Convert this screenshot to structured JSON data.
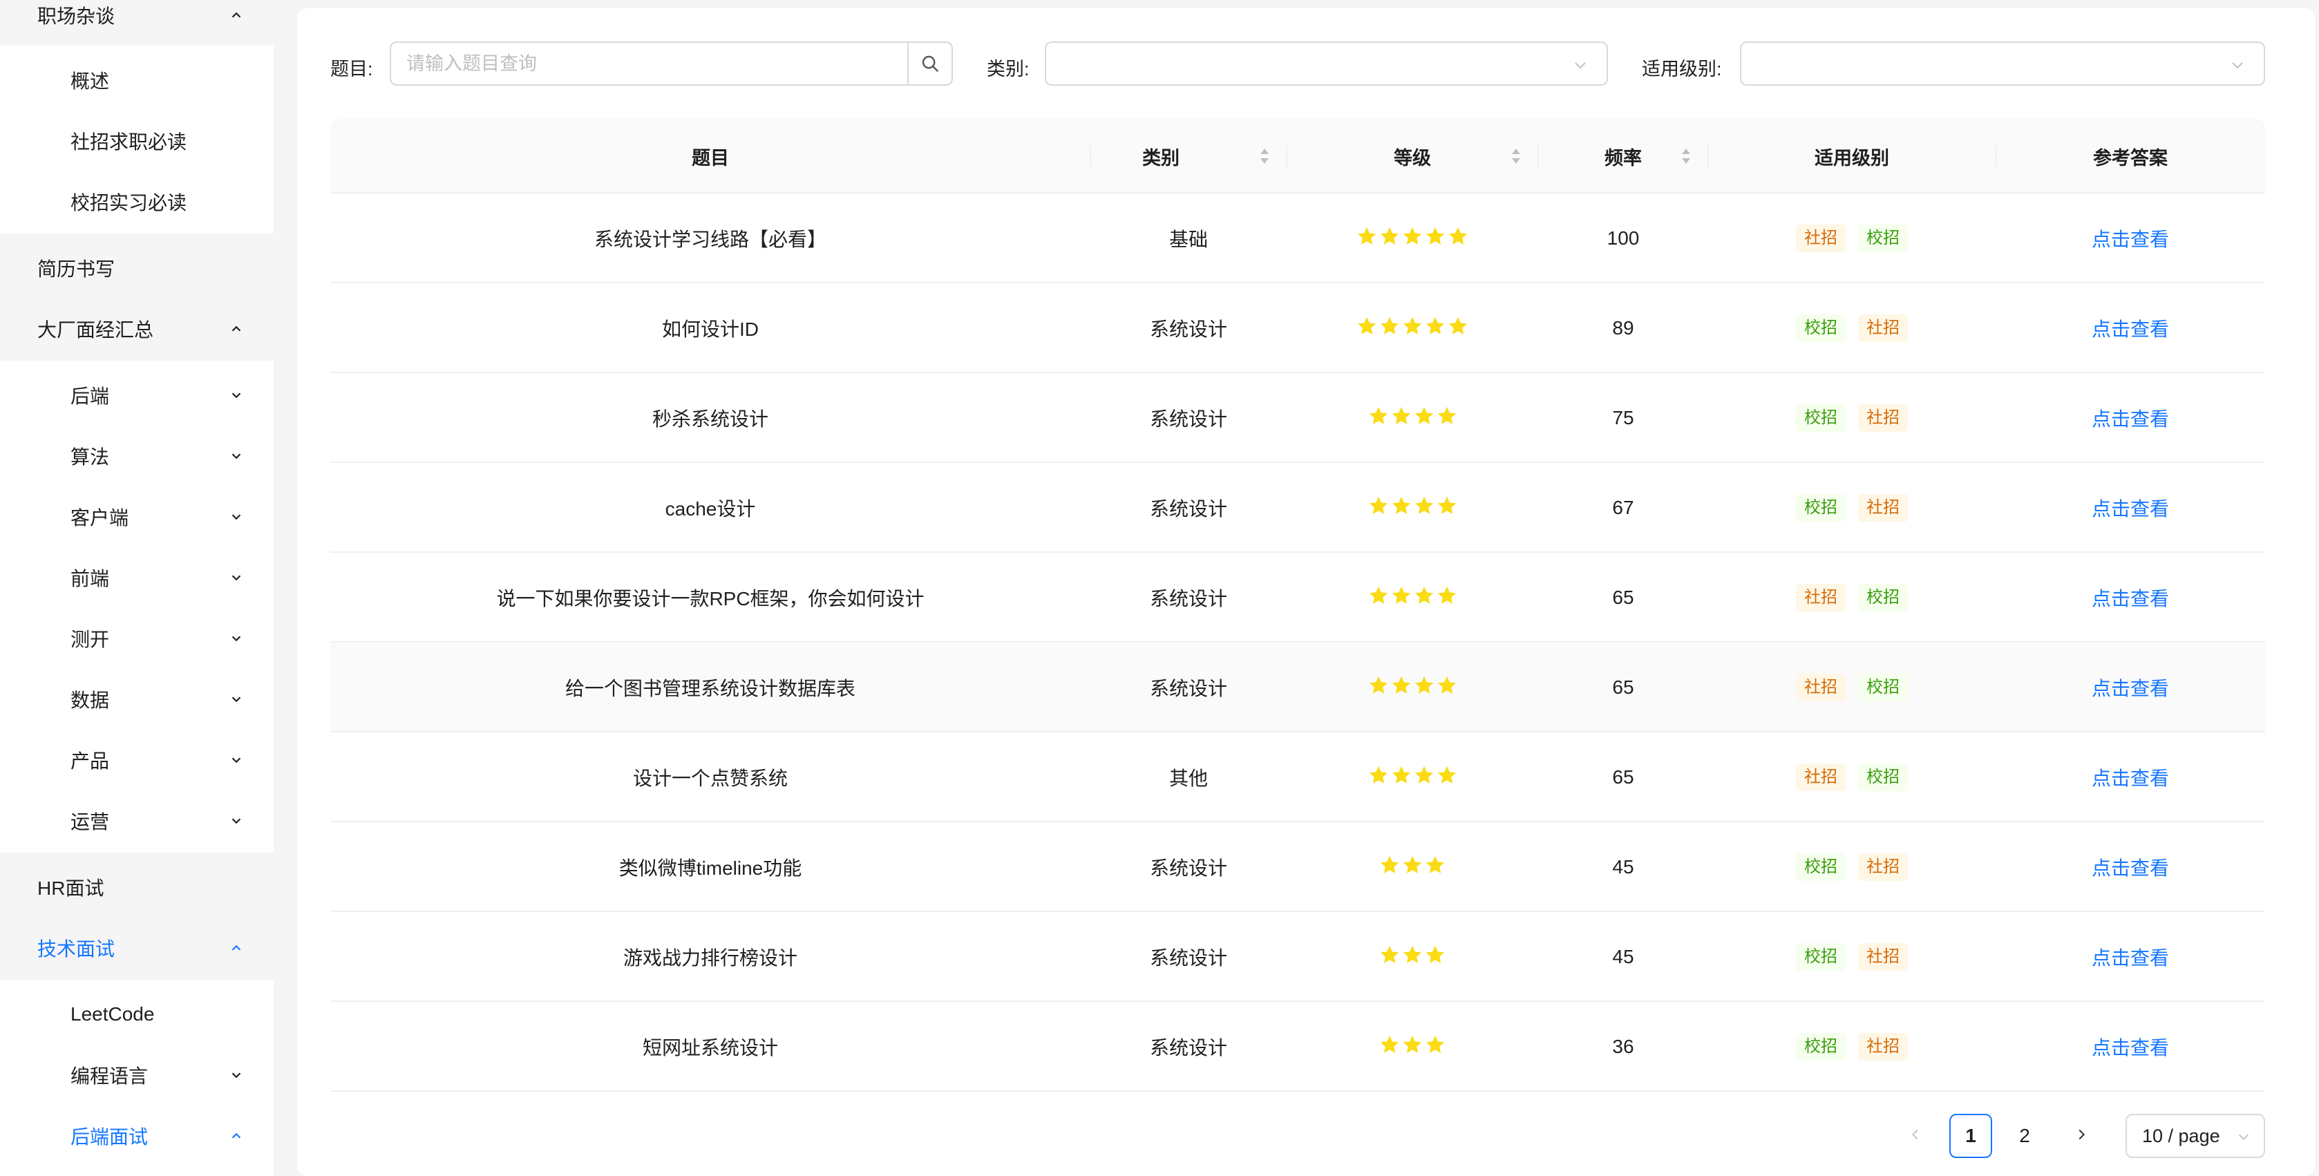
{
  "sidebar": {
    "items": [
      {
        "label": "职场杂谈",
        "level": 1,
        "expanded": true,
        "active": false,
        "chevron": "up"
      },
      {
        "label": "概述",
        "level": 2,
        "active": false,
        "chevron": null
      },
      {
        "label": "社招求职必读",
        "level": 2,
        "active": false,
        "chevron": null
      },
      {
        "label": "校招实习必读",
        "level": 2,
        "active": false,
        "chevron": null
      },
      {
        "label": "简历书写",
        "level": 1,
        "active": false,
        "chevron": null
      },
      {
        "label": "大厂面经汇总",
        "level": 1,
        "expanded": true,
        "active": false,
        "chevron": "up"
      },
      {
        "label": "后端",
        "level": 2,
        "active": false,
        "chevron": "down"
      },
      {
        "label": "算法",
        "level": 2,
        "active": false,
        "chevron": "down"
      },
      {
        "label": "客户端",
        "level": 2,
        "active": false,
        "chevron": "down"
      },
      {
        "label": "前端",
        "level": 2,
        "active": false,
        "chevron": "down"
      },
      {
        "label": "测开",
        "level": 2,
        "active": false,
        "chevron": "down"
      },
      {
        "label": "数据",
        "level": 2,
        "active": false,
        "chevron": "down"
      },
      {
        "label": "产品",
        "level": 2,
        "active": false,
        "chevron": "down"
      },
      {
        "label": "运营",
        "level": 2,
        "active": false,
        "chevron": "down"
      },
      {
        "label": "HR面试",
        "level": 1,
        "active": false,
        "chevron": null
      },
      {
        "label": "技术面试",
        "level": 1,
        "expanded": true,
        "active": true,
        "chevron": "up"
      },
      {
        "label": "LeetCode",
        "level": 2,
        "active": false,
        "chevron": null
      },
      {
        "label": "编程语言",
        "level": 2,
        "active": false,
        "chevron": "down"
      },
      {
        "label": "后端面试",
        "level": 2,
        "active": true,
        "chevron": "up"
      }
    ]
  },
  "filters": {
    "title_label": "题目:",
    "title_placeholder": "请输入题目查询",
    "title_value": "",
    "category_label": "类别:",
    "category_value": "",
    "level_label": "适用级别:",
    "level_value": ""
  },
  "table": {
    "columns": [
      {
        "key": "title",
        "label": "题目",
        "sortable": false
      },
      {
        "key": "category",
        "label": "类别",
        "sortable": true
      },
      {
        "key": "grade",
        "label": "等级",
        "sortable": true
      },
      {
        "key": "frequency",
        "label": "频率",
        "sortable": true
      },
      {
        "key": "levels",
        "label": "适用级别",
        "sortable": false
      },
      {
        "key": "answer",
        "label": "参考答案",
        "sortable": false
      }
    ],
    "rows": [
      {
        "title": "系统设计学习线路【必看】",
        "category": "基础",
        "stars": 5,
        "frequency": "100",
        "tags": [
          "社招",
          "校招"
        ],
        "answer": "点击查看"
      },
      {
        "title": "如何设计ID",
        "category": "系统设计",
        "stars": 5,
        "frequency": "89",
        "tags": [
          "校招",
          "社招"
        ],
        "answer": "点击查看"
      },
      {
        "title": "秒杀系统设计",
        "category": "系统设计",
        "stars": 4,
        "frequency": "75",
        "tags": [
          "校招",
          "社招"
        ],
        "answer": "点击查看"
      },
      {
        "title": "cache设计",
        "category": "系统设计",
        "stars": 4,
        "frequency": "67",
        "tags": [
          "校招",
          "社招"
        ],
        "answer": "点击查看"
      },
      {
        "title": "说一下如果你要设计一款RPC框架，你会如何设计",
        "category": "系统设计",
        "stars": 4,
        "frequency": "65",
        "tags": [
          "社招",
          "校招"
        ],
        "answer": "点击查看"
      },
      {
        "title": "给一个图书管理系统设计数据库表",
        "category": "系统设计",
        "stars": 4,
        "frequency": "65",
        "tags": [
          "社招",
          "校招"
        ],
        "answer": "点击查看"
      },
      {
        "title": "设计一个点赞系统",
        "category": "其他",
        "stars": 4,
        "frequency": "65",
        "tags": [
          "社招",
          "校招"
        ],
        "answer": "点击查看"
      },
      {
        "title": "类似微博timeline功能",
        "category": "系统设计",
        "stars": 3,
        "frequency": "45",
        "tags": [
          "校招",
          "社招"
        ],
        "answer": "点击查看"
      },
      {
        "title": "游戏战力排行榜设计",
        "category": "系统设计",
        "stars": 3,
        "frequency": "45",
        "tags": [
          "校招",
          "社招"
        ],
        "answer": "点击查看"
      },
      {
        "title": "短网址系统设计",
        "category": "系统设计",
        "stars": 3,
        "frequency": "36",
        "tags": [
          "校招",
          "社招"
        ],
        "answer": "点击查看"
      }
    ],
    "hover_row": 5
  },
  "pagination": {
    "pages": [
      "1",
      "2"
    ],
    "current": "1",
    "page_size": "10 / page"
  },
  "colors": {
    "accent": "#1677ff",
    "star": "#fadb14",
    "tag_orange_text": "#d46b08",
    "tag_orange_bg": "#fff7e6",
    "tag_green_text": "#389e0d",
    "tag_green_bg": "#f6ffed"
  },
  "icons": {
    "search": "search-icon",
    "select_arrow": "chevron-down-icon",
    "expand_up": "chevron-up-icon",
    "expand_down": "chevron-down-icon",
    "star": "star-icon",
    "prev": "chevron-left-icon",
    "next": "chevron-right-icon"
  }
}
